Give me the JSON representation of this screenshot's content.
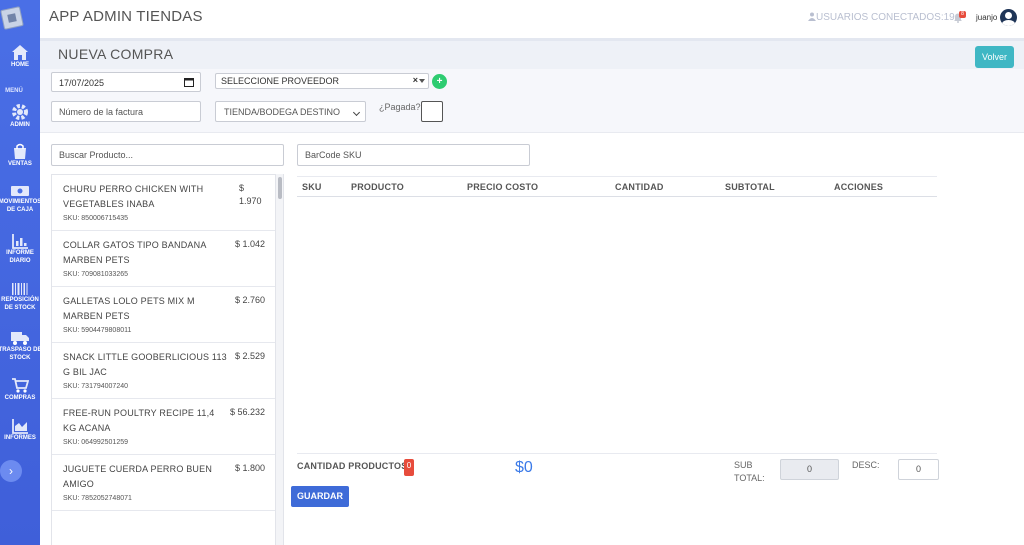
{
  "app": {
    "title": "APP ADMIN TIENDAS"
  },
  "header": {
    "users_online": "USUARIOS CONECTADOS:19",
    "notifications_count": "8",
    "username": "juanjo"
  },
  "sidebar": {
    "menu_title": "MENÚ",
    "items": [
      {
        "label": "HOME",
        "icon": "home-icon"
      },
      {
        "label": "ADMIN",
        "icon": "gear-icon"
      },
      {
        "label": "VENTAS",
        "icon": "shopping-bag-icon"
      },
      {
        "label": "MOVIMIENTOS",
        "label2": "DE CAJA",
        "icon": "money-icon"
      },
      {
        "label": "INFORME",
        "label2": "DIARIO",
        "icon": "bar-chart-icon"
      },
      {
        "label": "REPOSICIÓN",
        "label2": "DE STOCK",
        "icon": "barcode-icon"
      },
      {
        "label": "TRASPASO DE",
        "label2": "STOCK",
        "icon": "truck-icon"
      },
      {
        "label": "COMPRAS",
        "icon": "cart-icon"
      },
      {
        "label": "INFORMES",
        "icon": "area-chart-icon"
      }
    ],
    "toggle": "›"
  },
  "page": {
    "title": "NUEVA COMPRA",
    "back_label": "Volver"
  },
  "form": {
    "date": "17/07/2025",
    "supplier": "SELECCIONE PROVEEDOR",
    "supplier_clear": "×",
    "add_supplier": "+",
    "invoice_placeholder": "Número de la factura",
    "store": "TIENDA/BODEGA DESTINO",
    "paid_label": "¿Pagada?"
  },
  "product_search": {
    "placeholder": "Buscar Producto..."
  },
  "products": [
    {
      "name": "CHURU PERRO CHICKEN WITH VEGETABLES INABA",
      "price": "$ 1.970",
      "sku": "SKU: 850006715435"
    },
    {
      "name": "COLLAR GATOS TIPO BANDANA MARBEN PETS",
      "price": "$ 1.042",
      "sku": "SKU: 709081033265"
    },
    {
      "name": "GALLETAS LOLO PETS MIX M MARBEN PETS",
      "price": "$ 2.760",
      "sku": "SKU: 5904479808011"
    },
    {
      "name": "SNACK LITTLE GOOBERLICIOUS 113 G BIL JAC",
      "price": "$ 2.529",
      "sku": "SKU: 731794007240"
    },
    {
      "name": "FREE-RUN POULTRY RECIPE 11,4 KG ACANA",
      "price": "$ 56.232",
      "sku": "SKU: 064992501259"
    },
    {
      "name": "JUGUETE CUERDA PERRO BUEN AMIGO",
      "price": "$ 1.800",
      "sku": "SKU: 7852052748071"
    }
  ],
  "barcode": {
    "placeholder": "BarCode SKU"
  },
  "table": {
    "columns": [
      "SKU",
      "PRODUCTO",
      "PRECIO COSTO",
      "CANTIDAD",
      "SUBTOTAL",
      "ACCIONES"
    ]
  },
  "footer": {
    "qty_label": "CANTIDAD PRODUCTOS",
    "qty_value": "0",
    "total": "$0",
    "subtotal_label_1": "SUB",
    "subtotal_label_2": "TOTAL:",
    "subtotal_value": "0",
    "desc_label": "DESC:",
    "desc_value": "0",
    "save_label": "GUARDAR"
  },
  "colors": {
    "sidebar": "#4a6fe6",
    "accent": "#3e6bd8",
    "back_button": "#3fb7c4",
    "badge": "#e74c3c",
    "total": "#3b7ae8",
    "add": "#2ecc71"
  }
}
